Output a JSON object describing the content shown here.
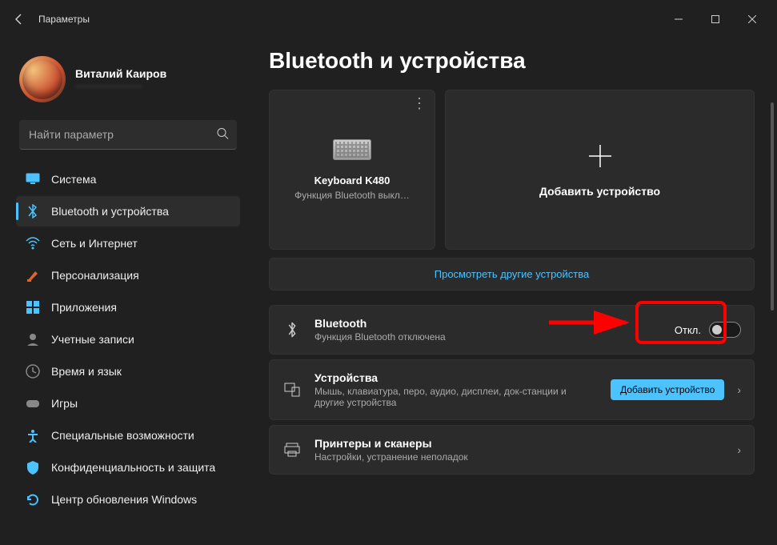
{
  "window": {
    "title": "Параметры"
  },
  "profile": {
    "name": "Виталий Каиров",
    "email": "———————"
  },
  "search": {
    "placeholder": "Найти параметр"
  },
  "nav": [
    {
      "id": "system",
      "label": "Система",
      "icon": "monitor",
      "color": "#4cc2ff"
    },
    {
      "id": "bluetooth",
      "label": "Bluetooth и устройства",
      "icon": "bluetooth",
      "color": "#4cc2ff",
      "active": true
    },
    {
      "id": "network",
      "label": "Сеть и Интернет",
      "icon": "wifi",
      "color": "#4cc2ff"
    },
    {
      "id": "personalize",
      "label": "Персонализация",
      "icon": "brush",
      "color": "#e06526"
    },
    {
      "id": "apps",
      "label": "Приложения",
      "icon": "apps",
      "color": "#4cc2ff"
    },
    {
      "id": "accounts",
      "label": "Учетные записи",
      "icon": "person",
      "color": "#888"
    },
    {
      "id": "time",
      "label": "Время и язык",
      "icon": "clock",
      "color": "#888"
    },
    {
      "id": "games",
      "label": "Игры",
      "icon": "gamepad",
      "color": "#888"
    },
    {
      "id": "access",
      "label": "Специальные возможности",
      "icon": "access",
      "color": "#4cc2ff"
    },
    {
      "id": "privacy",
      "label": "Конфиденциальность и защита",
      "icon": "shield",
      "color": "#4cc2ff"
    },
    {
      "id": "update",
      "label": "Центр обновления Windows",
      "icon": "update",
      "color": "#4cc2ff"
    }
  ],
  "page": {
    "title": "Bluetooth и устройства",
    "device_card": {
      "name": "Keyboard K480",
      "sub": "Функция Bluetooth выкл…"
    },
    "add_card": {
      "label": "Добавить устройство"
    },
    "view_more": "Просмотреть другие устройства",
    "rows": {
      "bt": {
        "title": "Bluetooth",
        "sub": "Функция Bluetooth отключена",
        "toggle_label": "Откл.",
        "state": "off"
      },
      "devices": {
        "title": "Устройства",
        "sub": "Мышь, клавиатура, перо, аудио, дисплеи, док-станции и другие устройства",
        "button": "Добавить устройство"
      },
      "printers": {
        "title": "Принтеры и сканеры",
        "sub": "Настройки, устранение неполадок"
      }
    }
  }
}
